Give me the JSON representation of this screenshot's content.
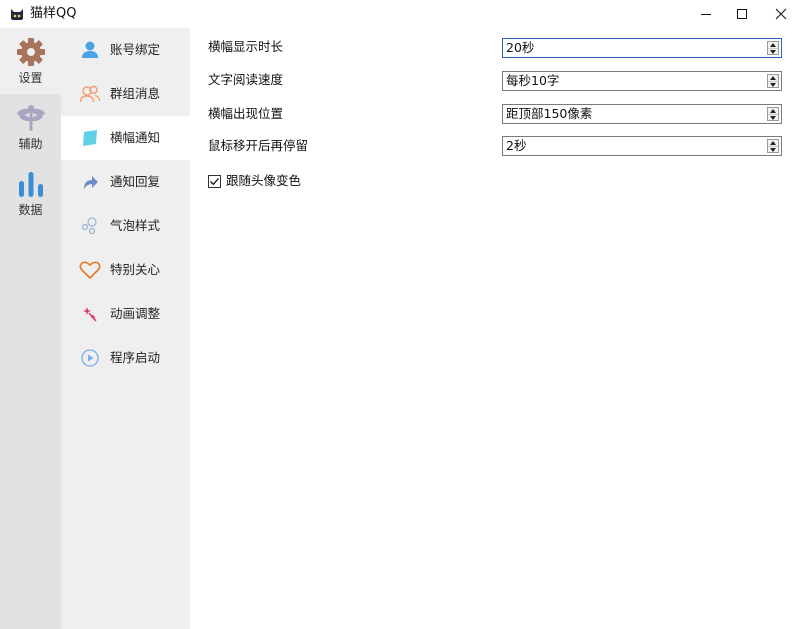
{
  "window": {
    "title": "猫样QQ",
    "app_icon": "cat-icon",
    "controls": [
      "minimize-icon",
      "maximize-icon",
      "close-icon"
    ]
  },
  "rail": {
    "items": [
      {
        "label": "设置",
        "icon": "gear-icon",
        "active": true
      },
      {
        "label": "辅助",
        "icon": "dragonfly-icon",
        "active": false
      },
      {
        "label": "数据",
        "icon": "bar-chart-icon",
        "active": false
      }
    ]
  },
  "menu": {
    "items": [
      {
        "label": "账号绑定",
        "icon": "user-icon",
        "active": false
      },
      {
        "label": "群组消息",
        "icon": "group-icon",
        "active": false
      },
      {
        "label": "横幅通知",
        "icon": "banner-icon",
        "active": true
      },
      {
        "label": "通知回复",
        "icon": "reply-arrow-icon",
        "active": false
      },
      {
        "label": "气泡样式",
        "icon": "bubbles-icon",
        "active": false
      },
      {
        "label": "特别关心",
        "icon": "heart-icon",
        "active": false
      },
      {
        "label": "动画调整",
        "icon": "sparkle-icon",
        "active": false
      },
      {
        "label": "程序启动",
        "icon": "play-icon",
        "active": false
      }
    ]
  },
  "settings": {
    "fields": [
      {
        "label": "横幅显示时长",
        "value": "20秒"
      },
      {
        "label": "文字阅读速度",
        "value": "每秒10字"
      },
      {
        "label": "横幅出现位置",
        "value": "距顶部150像素"
      },
      {
        "label": "鼠标移开后再停留",
        "value": "2秒"
      }
    ],
    "follow_avatar_color": {
      "label": "跟随头像变色",
      "checked": true
    }
  },
  "colors": {
    "rail_bg": "#e2e2e2",
    "menu_bg": "#efefef",
    "gear": "#a87460",
    "dragonfly": "#a9a6c2",
    "chart": "#3a8ed8",
    "focus_border": "#2b66c2"
  }
}
